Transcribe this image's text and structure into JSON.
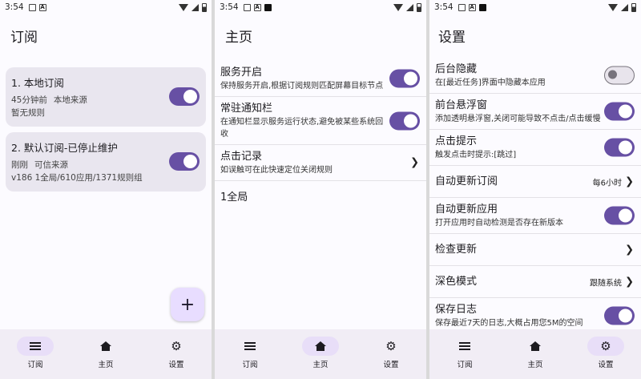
{
  "status": {
    "time": "3:54",
    "a_badge": "A"
  },
  "nav": [
    {
      "label": "订阅",
      "icon": "list-icon"
    },
    {
      "label": "主页",
      "icon": "home-icon"
    },
    {
      "label": "设置",
      "icon": "gear-icon"
    }
  ],
  "sub": {
    "title": "订阅",
    "fab": "+",
    "items": [
      {
        "title": "1. 本地订阅",
        "time": "45分钟前",
        "source": "本地来源",
        "info": "暂无规则",
        "enabled": true
      },
      {
        "title": "2. 默认订阅-已停止维护",
        "time": "刚刚",
        "source": "可信来源",
        "info": "v186  1全局/610应用/1371规则组",
        "enabled": true
      }
    ]
  },
  "home": {
    "title": "主页",
    "service": {
      "title": "服务开启",
      "desc": "保持服务开启,根据订阅规则匹配屏幕目标节点",
      "enabled": true
    },
    "notify": {
      "title": "常驻通知栏",
      "desc": "在通知栏显示服务运行状态,避免被某些系统回收",
      "enabled": true
    },
    "clicklog": {
      "title": "点击记录",
      "desc": "如误触可在此快速定位关闭规则"
    },
    "global": "1全局"
  },
  "settings": {
    "title": "设置",
    "hide": {
      "title": "后台隐藏",
      "desc": "在[最近任务]界面中隐藏本应用",
      "enabled": false
    },
    "float": {
      "title": "前台悬浮窗",
      "desc": "添加透明悬浮窗,关闭可能导致不点击/点击缓慢",
      "enabled": true
    },
    "toast": {
      "title": "点击提示",
      "desc": "触发点击时提示:[跳过]",
      "enabled": true
    },
    "autosub": {
      "title": "自动更新订阅",
      "value": "每6小时"
    },
    "autoapp": {
      "title": "自动更新应用",
      "desc": "打开应用时自动检测是否存在新版本",
      "enabled": true
    },
    "check": {
      "title": "检查更新"
    },
    "dark": {
      "title": "深色模式",
      "value": "跟随系统"
    },
    "log": {
      "title": "保存日志",
      "desc": "保存最近7天的日志,大概占用您5M的空间",
      "enabled": true
    }
  }
}
